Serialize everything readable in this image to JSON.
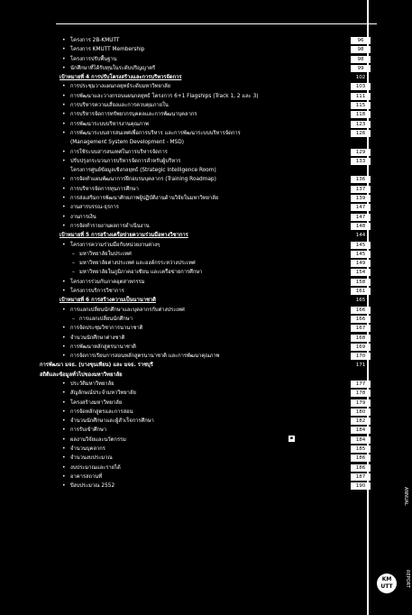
{
  "rows": [
    {
      "kind": "item",
      "text": "โครงการ 2B-KMUTT",
      "page": "96"
    },
    {
      "kind": "item",
      "text": "โครงการ KMUTT Membership",
      "page": "98"
    },
    {
      "kind": "item",
      "text": "โครงการปรับพื้นฐาน",
      "page": "98"
    },
    {
      "kind": "item",
      "text": "นักศึกษาที่ได้รับทุนในระดับปริญญาตรี",
      "page": "99"
    },
    {
      "kind": "sec",
      "text": "เป้าหมายที่ 4 การปรับโครงสร้างและการบริหารจัดการ",
      "page": "102"
    },
    {
      "kind": "item",
      "text": "การประชุมวางแผนกลยุทธ์ระดับมหาวิทยาลัย",
      "page": "103"
    },
    {
      "kind": "item",
      "text": "การพัฒนาและวางกรอบแผนกลยุทธ์ โครงการ 6+1 Flagships (Track 1, 2 และ 3)",
      "page": "111"
    },
    {
      "kind": "item",
      "text": "การบริหารความเสี่ยงและการควบคุมภายใน",
      "page": "115"
    },
    {
      "kind": "item",
      "text": "การบริหารจัดการทรัพยากรบุคคลและการพัฒนาบุคลากร",
      "page": "118"
    },
    {
      "kind": "item",
      "text": "การพัฒนาระบบบริหารงานคุณภาพ",
      "page": "123"
    },
    {
      "kind": "item",
      "text": "การพัฒนาระบบสารสนเทศเพื่อการบริหาร และการพัฒนาระบบบริหารจัดการ",
      "page": "126"
    },
    {
      "kind": "cont",
      "text": "(Management System Development - MSD)",
      "page": ""
    },
    {
      "kind": "item",
      "text": "การใช้ระบบสารสนเทศในการบริหารจัดการ",
      "page": "129"
    },
    {
      "kind": "item",
      "text": "ปรับปรุงกระบวนการบริหารจัดการสำหรับผู้บริหาร",
      "page": "133"
    },
    {
      "kind": "cont",
      "text": "โครงการศูนย์ข้อมูลเชิงกลยุทธ์ (Strategic Intelligence Room)",
      "page": ""
    },
    {
      "kind": "item",
      "text": "การจัดทำแผนพัฒนาการฝึกอบรมบุคลากร (Training Roadmap)",
      "page": "136"
    },
    {
      "kind": "item",
      "text": "การบริหารจัดการทุนการศึกษา",
      "page": "137"
    },
    {
      "kind": "item",
      "text": "การส่งเสริมการพัฒนาศักยภาพผู้ปฏิบัติงานด้านวิจัยในมหาวิทยาลัย",
      "page": "139"
    },
    {
      "kind": "item",
      "text": "งานสารบรรณ-ธุรการ",
      "page": "147"
    },
    {
      "kind": "item",
      "text": "งานการเงิน",
      "page": "147"
    },
    {
      "kind": "item",
      "text": "การจัดทำรายงานผลการดำเนินงาน",
      "page": "148"
    },
    {
      "kind": "sec",
      "text": "เป้าหมายที่ 5 การสร้างเครือข่ายความร่วมมือทางวิชาการ",
      "page": "144"
    },
    {
      "kind": "item",
      "text": "โครงการความร่วมมือกับหน่วยงานต่างๆ",
      "page": "145"
    },
    {
      "kind": "ind",
      "text": "มหาวิทยาลัยในประเทศ",
      "page": "145"
    },
    {
      "kind": "ind",
      "text": "มหาวิทยาลัยต่างประเทศ และองค์กรระหว่างประเทศ",
      "page": "149"
    },
    {
      "kind": "ind",
      "text": "มหาวิทยาลัยในภูมิภาคอาเซียน และเครือข่ายการศึกษา",
      "page": "154"
    },
    {
      "kind": "item",
      "text": "โครงการร่วมกับภาคอุตสาหกรรม",
      "page": "158"
    },
    {
      "kind": "item",
      "text": "โครงการบริการวิชาการ",
      "page": "161"
    },
    {
      "kind": "sec",
      "text": "เป้าหมายที่ 6 การสร้างความเป็นนานาชาติ",
      "page": "165"
    },
    {
      "kind": "item",
      "text": "การแลกเปลี่ยนนักศึกษาและบุคลากรกับต่างประเทศ",
      "page": "166"
    },
    {
      "kind": "ind",
      "text": "การแลกเปลี่ยนนักศึกษา",
      "page": "166"
    },
    {
      "kind": "item",
      "text": "การจัดประชุมวิชาการนานาชาติ",
      "page": "167"
    },
    {
      "kind": "item",
      "text": "จำนวนนักศึกษาต่างชาติ",
      "page": "168"
    },
    {
      "kind": "item",
      "text": "การพัฒนาหลักสูตรนานาชาติ",
      "page": "169"
    },
    {
      "kind": "item",
      "text": "การจัดการเรียนการสอนหลักสูตรนานาชาติ และการพัฒนาคุณภาพ",
      "page": "170"
    },
    {
      "kind": "top",
      "text": "การพัฒนา มจธ. (บางขุนเทียน) และ มจธ. ราชบุรี",
      "page": "171"
    },
    {
      "kind": "top",
      "text": "สถิติและข้อมูลทั่วไปของมหาวิทยาลัย",
      "page": ""
    },
    {
      "kind": "item",
      "text": "ประวัติมหาวิทยาลัย",
      "page": "177"
    },
    {
      "kind": "item",
      "text": "สัญลักษณ์ประจำมหาวิทยาลัย",
      "page": "178"
    },
    {
      "kind": "item",
      "text": "โครงสร้างมหาวิทยาลัย",
      "page": "179"
    },
    {
      "kind": "item",
      "text": "การจัดหลักสูตรและการสอน",
      "page": "180"
    },
    {
      "kind": "item",
      "text": "จำนวนนักศึกษาและผู้สำเร็จการศึกษา",
      "page": "182"
    },
    {
      "kind": "item",
      "text": "การรับเข้าศึกษา",
      "page": "184"
    },
    {
      "kind": "item",
      "text": "ผลงานวิจัยและนวัตกรรม",
      "page": "184"
    },
    {
      "kind": "item",
      "text": "จำนวนบุคลากร",
      "page": "185"
    },
    {
      "kind": "item",
      "text": "จำนวนงบประมาณ",
      "page": "186"
    },
    {
      "kind": "item",
      "text": "งบประมาณและรายได้",
      "page": "186"
    },
    {
      "kind": "item",
      "text": "อาคารสถานที่",
      "page": "187"
    },
    {
      "kind": "item",
      "text": "ปีงบประมาณ 2552",
      "page": "190"
    }
  ],
  "logo_text": "KM UTT",
  "edge_text": "ANNUAL",
  "edge_text2": "REPORT"
}
